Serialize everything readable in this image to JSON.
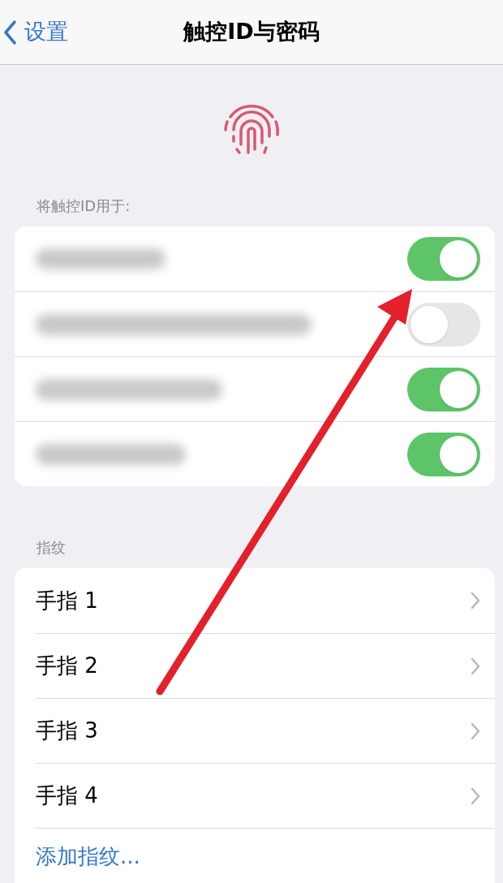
{
  "nav_bar": {
    "back_label": "设置",
    "title": "触控ID与密码"
  },
  "touch_id_section": {
    "header": "将触控ID用于:",
    "toggles": [
      {
        "on": true
      },
      {
        "on": false
      },
      {
        "on": true
      },
      {
        "on": true
      }
    ]
  },
  "fingerprints_section": {
    "header": "指纹",
    "fingerprints": [
      {
        "label": "手指 1"
      },
      {
        "label": "手指 2"
      },
      {
        "label": "手指 3"
      },
      {
        "label": "手指 4"
      }
    ],
    "add_link": "添加指纹..."
  }
}
